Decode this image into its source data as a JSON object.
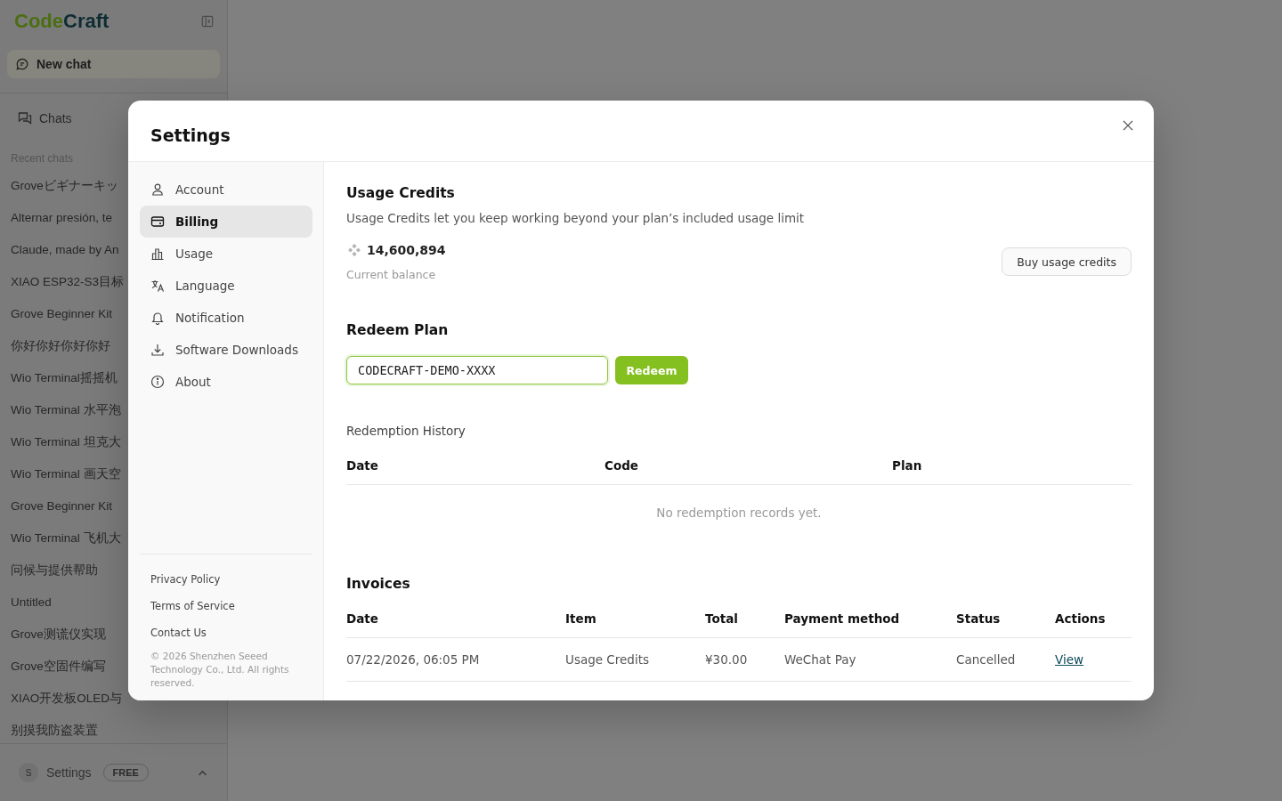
{
  "sidebar": {
    "logo": {
      "prefix": "Code",
      "suffix": "Craft"
    },
    "new_chat_button": "New chat",
    "nav": [
      {
        "label": "Chats",
        "selected": false
      }
    ],
    "section_label": "Recent chats",
    "recent_chats": [
      {
        "title": "Groveビギナーキッ",
        "selected": false
      },
      {
        "title": "Alternar presión, te",
        "selected": false
      },
      {
        "title": "Claude, made by An",
        "selected": false
      },
      {
        "title": "XIAO ESP32-S3目标",
        "selected": false
      },
      {
        "title": "Grove Beginner Kit",
        "selected": false
      },
      {
        "title": "你好你好你好你好",
        "selected": false
      },
      {
        "title": "Wio Terminal摇摇机",
        "selected": false
      },
      {
        "title": "Wio Terminal 水平泡",
        "selected": false
      },
      {
        "title": "Wio Terminal 坦克大",
        "selected": false
      },
      {
        "title": "Wio Terminal 画天空",
        "selected": false
      },
      {
        "title": "Grove Beginner Kit",
        "selected": false
      },
      {
        "title": "Wio Terminal 飞机大",
        "selected": false
      },
      {
        "title": "问候与提供帮助",
        "selected": false
      },
      {
        "title": "Untitled",
        "selected": false
      },
      {
        "title": "Grove测谎仪实现",
        "selected": false
      },
      {
        "title": "Grove空固件编写",
        "selected": false
      },
      {
        "title": "XIAO开发板OLED与",
        "selected": false
      },
      {
        "title": "别摸我防盗装置",
        "selected": false
      }
    ],
    "user": {
      "avatar": "S",
      "label": "Settings",
      "plan_badge": "FREE"
    }
  },
  "settings_dialog": {
    "title": "Settings",
    "nav": [
      {
        "label": "Account",
        "selected": false
      },
      {
        "label": "Billing",
        "selected": true
      },
      {
        "label": "Usage",
        "selected": false
      },
      {
        "label": "Language",
        "selected": false
      },
      {
        "label": "Notification",
        "selected": false
      },
      {
        "label": "Software Downloads",
        "selected": false
      },
      {
        "label": "About",
        "selected": false
      }
    ],
    "footer_links": [
      "Privacy Policy",
      "Terms of Service",
      "Contact Us"
    ],
    "copyright": "© 2026 Shenzhen Seeed Technology Co., Ltd. All rights reserved.",
    "usage_credits": {
      "heading": "Usage Credits",
      "description": "Usage Credits let you keep working beyond your plan’s included usage limit",
      "balance": "14,600,894",
      "balance_label": "Current balance",
      "buy_button": "Buy usage credits"
    },
    "redeem_plan": {
      "heading": "Redeem Plan",
      "code_field": {
        "value": "CODECRAFT-DEMO-XXXX"
      },
      "redeem_button": "Redeem"
    },
    "redemption_history": {
      "heading": "Redemption History",
      "columns": [
        "Date",
        "Code",
        "Plan"
      ],
      "empty_message": "No redemption records yet."
    },
    "invoices": {
      "heading": "Invoices",
      "columns": [
        "Date",
        "Item",
        "Total",
        "Payment method",
        "Status",
        "Actions"
      ],
      "rows": [
        {
          "date": "07/22/2026, 06:05 PM",
          "item": "Usage Credits",
          "total": "¥30.00",
          "payment_method": "WeChat Pay",
          "status": "Cancelled",
          "action": "View"
        }
      ]
    }
  }
}
